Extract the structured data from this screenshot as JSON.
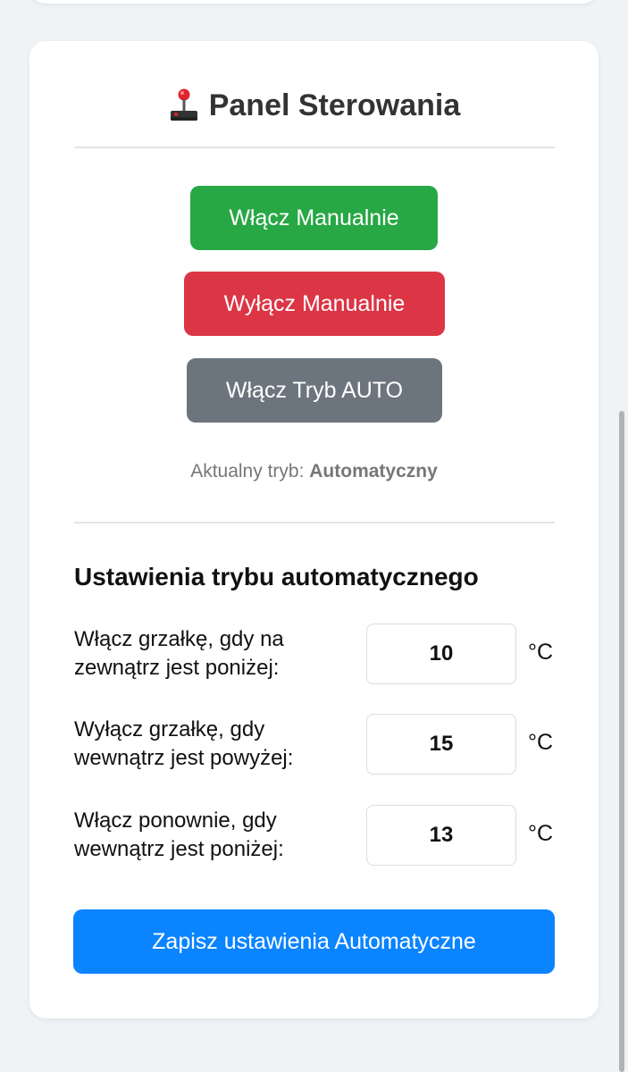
{
  "panel": {
    "title": "Panel Sterowania",
    "title_icon": "joystick-icon"
  },
  "buttons": {
    "manual_on": "Włącz Manualnie",
    "manual_off": "Wyłącz Manualnie",
    "auto_on": "Włącz Tryb AUTO"
  },
  "mode": {
    "label": "Aktualny tryb:",
    "value": "Automatyczny"
  },
  "auto_settings": {
    "title": "Ustawienia trybu automatycznego",
    "rows": [
      {
        "label": "Włącz grzałkę, gdy na zewnątrz jest poniżej:",
        "value": "10",
        "unit": "°C"
      },
      {
        "label": "Wyłącz grzałkę, gdy wewnątrz jest powyżej:",
        "value": "15",
        "unit": "°C"
      },
      {
        "label": "Włącz ponownie, gdy wewnątrz jest poniżej:",
        "value": "13",
        "unit": "°C"
      }
    ],
    "save_label": "Zapisz ustawienia Automatyczne"
  },
  "colors": {
    "manual_on": "#28a745",
    "manual_off": "#dc3545",
    "auto_on": "#6c757d",
    "save": "#0a84ff"
  }
}
